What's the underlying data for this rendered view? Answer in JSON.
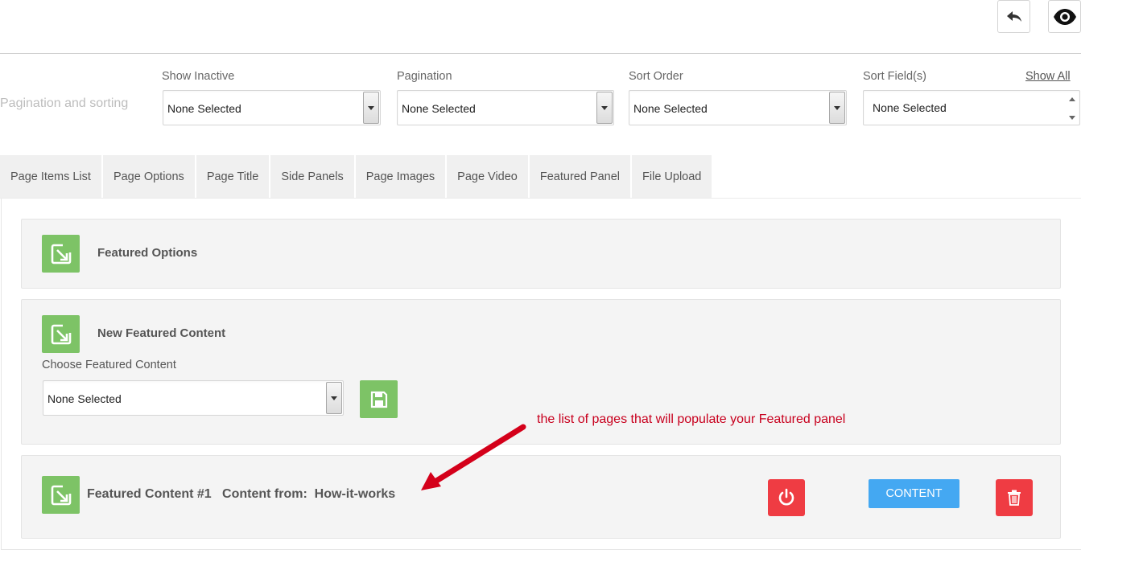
{
  "toolbar": {
    "undo_icon": "undo-arrow-icon",
    "view_icon": "eye-icon"
  },
  "filters": {
    "section_label": "Pagination and sorting",
    "show_inactive": {
      "label": "Show Inactive",
      "value": "None Selected"
    },
    "pagination": {
      "label": "Pagination",
      "value": "None Selected"
    },
    "sort_order": {
      "label": "Sort Order",
      "value": "None Selected"
    },
    "sort_fields": {
      "label": "Sort Field(s)",
      "value": "None Selected"
    },
    "show_all": "Show All"
  },
  "tabs": [
    "Page Items List",
    "Page Options",
    "Page Title",
    "Side Panels",
    "Page Images",
    "Page Video",
    "Featured Panel",
    "File Upload"
  ],
  "panels": {
    "featured_options": {
      "title": "Featured Options"
    },
    "new_featured": {
      "title": "New Featured Content",
      "choose_label": "Choose Featured Content",
      "select_value": "None Selected"
    },
    "featured_item": {
      "title": "Featured Content #1",
      "content_from": "Content from:  How-it-works",
      "content_button": "CONTENT"
    }
  },
  "annotation": {
    "text": "the list of pages that will populate your Featured panel"
  },
  "colors": {
    "green": "#7dc366",
    "red": "#ef3c43",
    "blue": "#44a8f2",
    "annotation": "#c8001e"
  }
}
